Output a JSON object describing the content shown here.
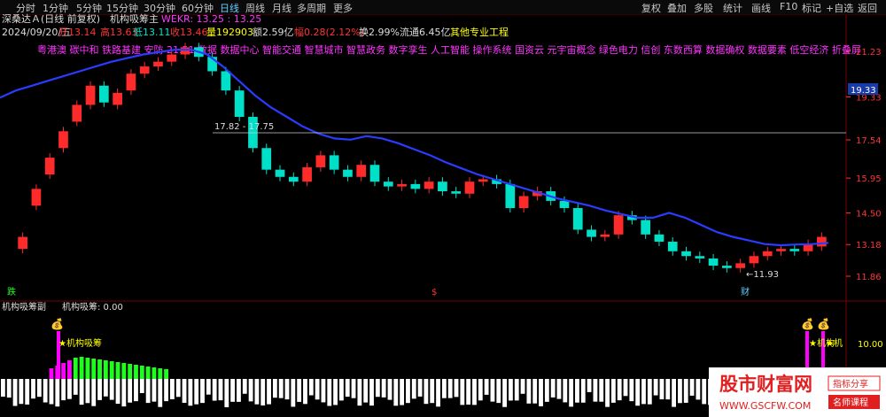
{
  "toolbar": {
    "periods": [
      "分时",
      "1分钟",
      "5分钟",
      "15分钟",
      "30分钟",
      "60分钟",
      "日线",
      "周线",
      "月线",
      "多周期",
      "更多"
    ],
    "active_period": "日线",
    "right_buttons": [
      "复权",
      "叠加",
      "多股",
      "统计",
      "画线",
      "F10",
      "标记",
      "+自选",
      "返回"
    ]
  },
  "header": {
    "title": "深桑达Ａ(日线 前复权)",
    "indicator_name": "机构吸筹主",
    "indicator_value": "WEKR: 13.25 : 13.25",
    "date": "2024/09/20/五",
    "open": "开13.14",
    "high": "高13.63",
    "low": "低13.11",
    "close": "收13.46",
    "volume": "量192903",
    "amount": "额2.59亿",
    "change": "幅0.28(2.12%)",
    "turnover": "换2.99%",
    "float": "流通6.45亿",
    "sector": "其他专业工程"
  },
  "concepts": "粤港澳 碳中和 铁路基建 安防 21.51 数据 数据中心 智能交通 智慧城市 智慧政务 数字孪生 人工智能 操作系统 国资云 元宇宙概念 绿色电力 信创 东数西算 数据确权 数据要素 低空经济 折叠屏",
  "price_axis": [
    "21.23",
    "19.33",
    "17.54",
    "15.95",
    "14.50",
    "13.18",
    "11.86"
  ],
  "current_price": "19.33",
  "annotations": {
    "range": "17.82 - 17.75",
    "low_label": "←11.93",
    "high_label": "21.51",
    "marker_die": "跌",
    "marker_dollar": "$",
    "marker_cai": "财"
  },
  "sub": {
    "title": "机构吸筹副",
    "value": "机构吸筹: 0.00",
    "axis_label": "10.00",
    "star_label": "★机构吸筹",
    "star_label2": "★机构",
    "star_label3": "★机",
    "bag_icon": "💰"
  },
  "watermark": {
    "name": "股市财富网",
    "url": "WWW.GSCFW.COM",
    "badge1": "指标分享",
    "badge2": "名师课程"
  },
  "colors": {
    "up": "#ff2a2a",
    "down": "#00e0c8",
    "ma": "#2a3cff",
    "bg": "#000000",
    "grid": "#5a0000",
    "magenta": "#ff00ff",
    "green": "#1eff1e",
    "white": "#ffffff"
  },
  "chart_data": {
    "type": "candlestick",
    "ma_y_values": [
      19.3,
      19.6,
      19.8,
      20.0,
      20.2,
      20.4,
      20.6,
      20.8,
      20.95,
      21.1,
      21.2,
      21.3,
      21.3,
      21.1,
      20.6,
      20.0,
      19.4,
      18.9,
      18.5,
      18.1,
      17.8,
      17.6,
      17.55,
      17.7,
      17.6,
      17.4,
      17.15,
      16.9,
      16.6,
      16.35,
      16.1,
      15.9,
      15.7,
      15.5,
      15.3,
      15.1,
      14.95,
      14.8,
      14.6,
      14.45,
      14.3,
      14.3,
      14.5,
      14.3,
      14.0,
      13.7,
      13.5,
      13.35,
      13.2,
      13.15,
      13.18,
      13.2,
      13.25
    ],
    "closes": [
      13.5,
      15.5,
      16.8,
      17.9,
      19.0,
      19.8,
      19.1,
      19.5,
      20.3,
      20.6,
      20.8,
      21.1,
      21.4,
      21.0,
      20.4,
      19.6,
      18.5,
      17.2,
      16.3,
      16.0,
      15.8,
      16.4,
      16.9,
      16.3,
      16.0,
      16.5,
      15.8,
      15.6,
      15.7,
      15.5,
      15.8,
      15.4,
      15.3,
      15.8,
      15.9,
      15.7,
      14.7,
      15.2,
      15.4,
      15.0,
      14.7,
      13.8,
      13.5,
      13.6,
      14.4,
      14.2,
      13.6,
      13.3,
      12.9,
      12.7,
      12.6,
      12.3,
      12.2,
      12.4,
      12.7,
      12.9,
      13.0,
      12.9,
      13.2,
      13.5
    ],
    "opens": [
      13.0,
      14.8,
      16.1,
      17.2,
      18.3,
      19.0,
      19.8,
      19.0,
      19.6,
      20.3,
      20.6,
      20.8,
      21.1,
      21.4,
      21.0,
      20.4,
      19.6,
      18.5,
      17.2,
      16.3,
      16.0,
      15.8,
      16.4,
      16.9,
      16.3,
      16.0,
      16.5,
      15.8,
      15.6,
      15.7,
      15.5,
      15.8,
      15.4,
      15.3,
      15.8,
      15.9,
      15.7,
      14.7,
      15.2,
      15.4,
      15.0,
      14.7,
      13.8,
      13.5,
      13.6,
      14.4,
      14.2,
      13.6,
      13.3,
      12.9,
      12.7,
      12.6,
      12.3,
      12.2,
      12.4,
      12.7,
      12.9,
      13.0,
      12.9,
      13.1
    ],
    "sub_values": [
      0,
      0,
      0,
      0,
      0,
      0,
      0,
      0,
      0,
      0,
      0,
      0,
      0,
      0,
      0,
      0,
      0,
      0,
      0,
      0,
      0,
      0,
      0,
      0,
      0,
      0,
      0,
      0,
      0,
      0,
      0,
      0,
      0,
      0,
      0,
      0,
      0,
      0,
      0,
      0,
      0,
      0,
      0,
      0,
      0,
      0,
      0,
      0,
      0,
      0,
      0,
      0,
      0,
      0,
      0,
      0,
      0,
      0,
      0,
      0
    ],
    "ylim": [
      11.86,
      21.23
    ]
  }
}
